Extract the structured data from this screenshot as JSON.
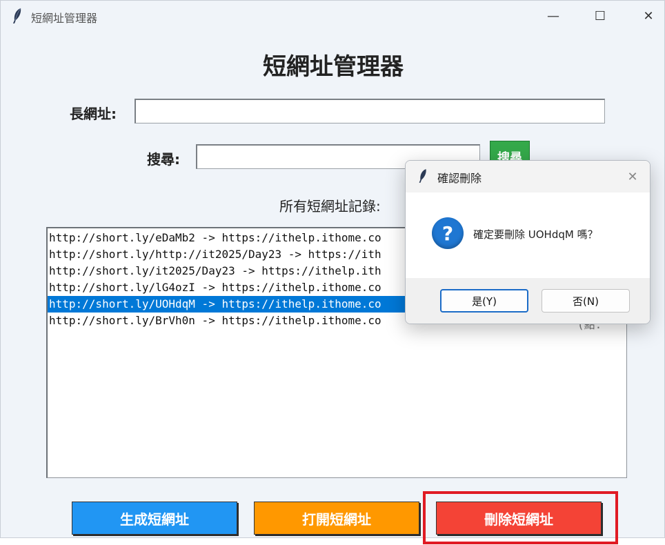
{
  "window": {
    "title": "短網址管理器",
    "controls": {
      "minimize": "—",
      "maximize": "☐",
      "close": "✕"
    }
  },
  "main": {
    "heading": "短網址管理器",
    "long_url_label": "長網址:",
    "long_url_value": "",
    "search_label": "搜尋:",
    "search_value": "",
    "search_button": "搜尋",
    "records_label": "所有短網址記錄:"
  },
  "records": [
    "http://short.ly/eDaMb2 -> https://ithelp.ithome.co",
    "http://short.ly/http://it2025/Day23 -> https://ith",
    "http://short.ly/it2025/Day23 -> https://ithelp.ith",
    "http://short.ly/lG4ozI -> https://ithelp.ithome.co",
    "http://short.ly/UOHdqM -> https://ithelp.ithome.co",
    "http://short.ly/BrVh0n -> https://ithelp.ithome.co"
  ],
  "selected_index": 4,
  "row_tail_text": "(點:",
  "actions": {
    "generate": "生成短網址",
    "open": "打開短網址",
    "delete": "刪除短網址"
  },
  "dialog": {
    "title": "確認刪除",
    "close": "✕",
    "icon": "?",
    "message": "確定要刪除 UOHdqM 嗎？",
    "yes": "是(Y)",
    "no": "否(N)"
  },
  "colors": {
    "generate": "#2196f3",
    "open": "#ff9800",
    "delete": "#f44336",
    "selection": "#0078d7",
    "highlight": "#e01b24"
  }
}
